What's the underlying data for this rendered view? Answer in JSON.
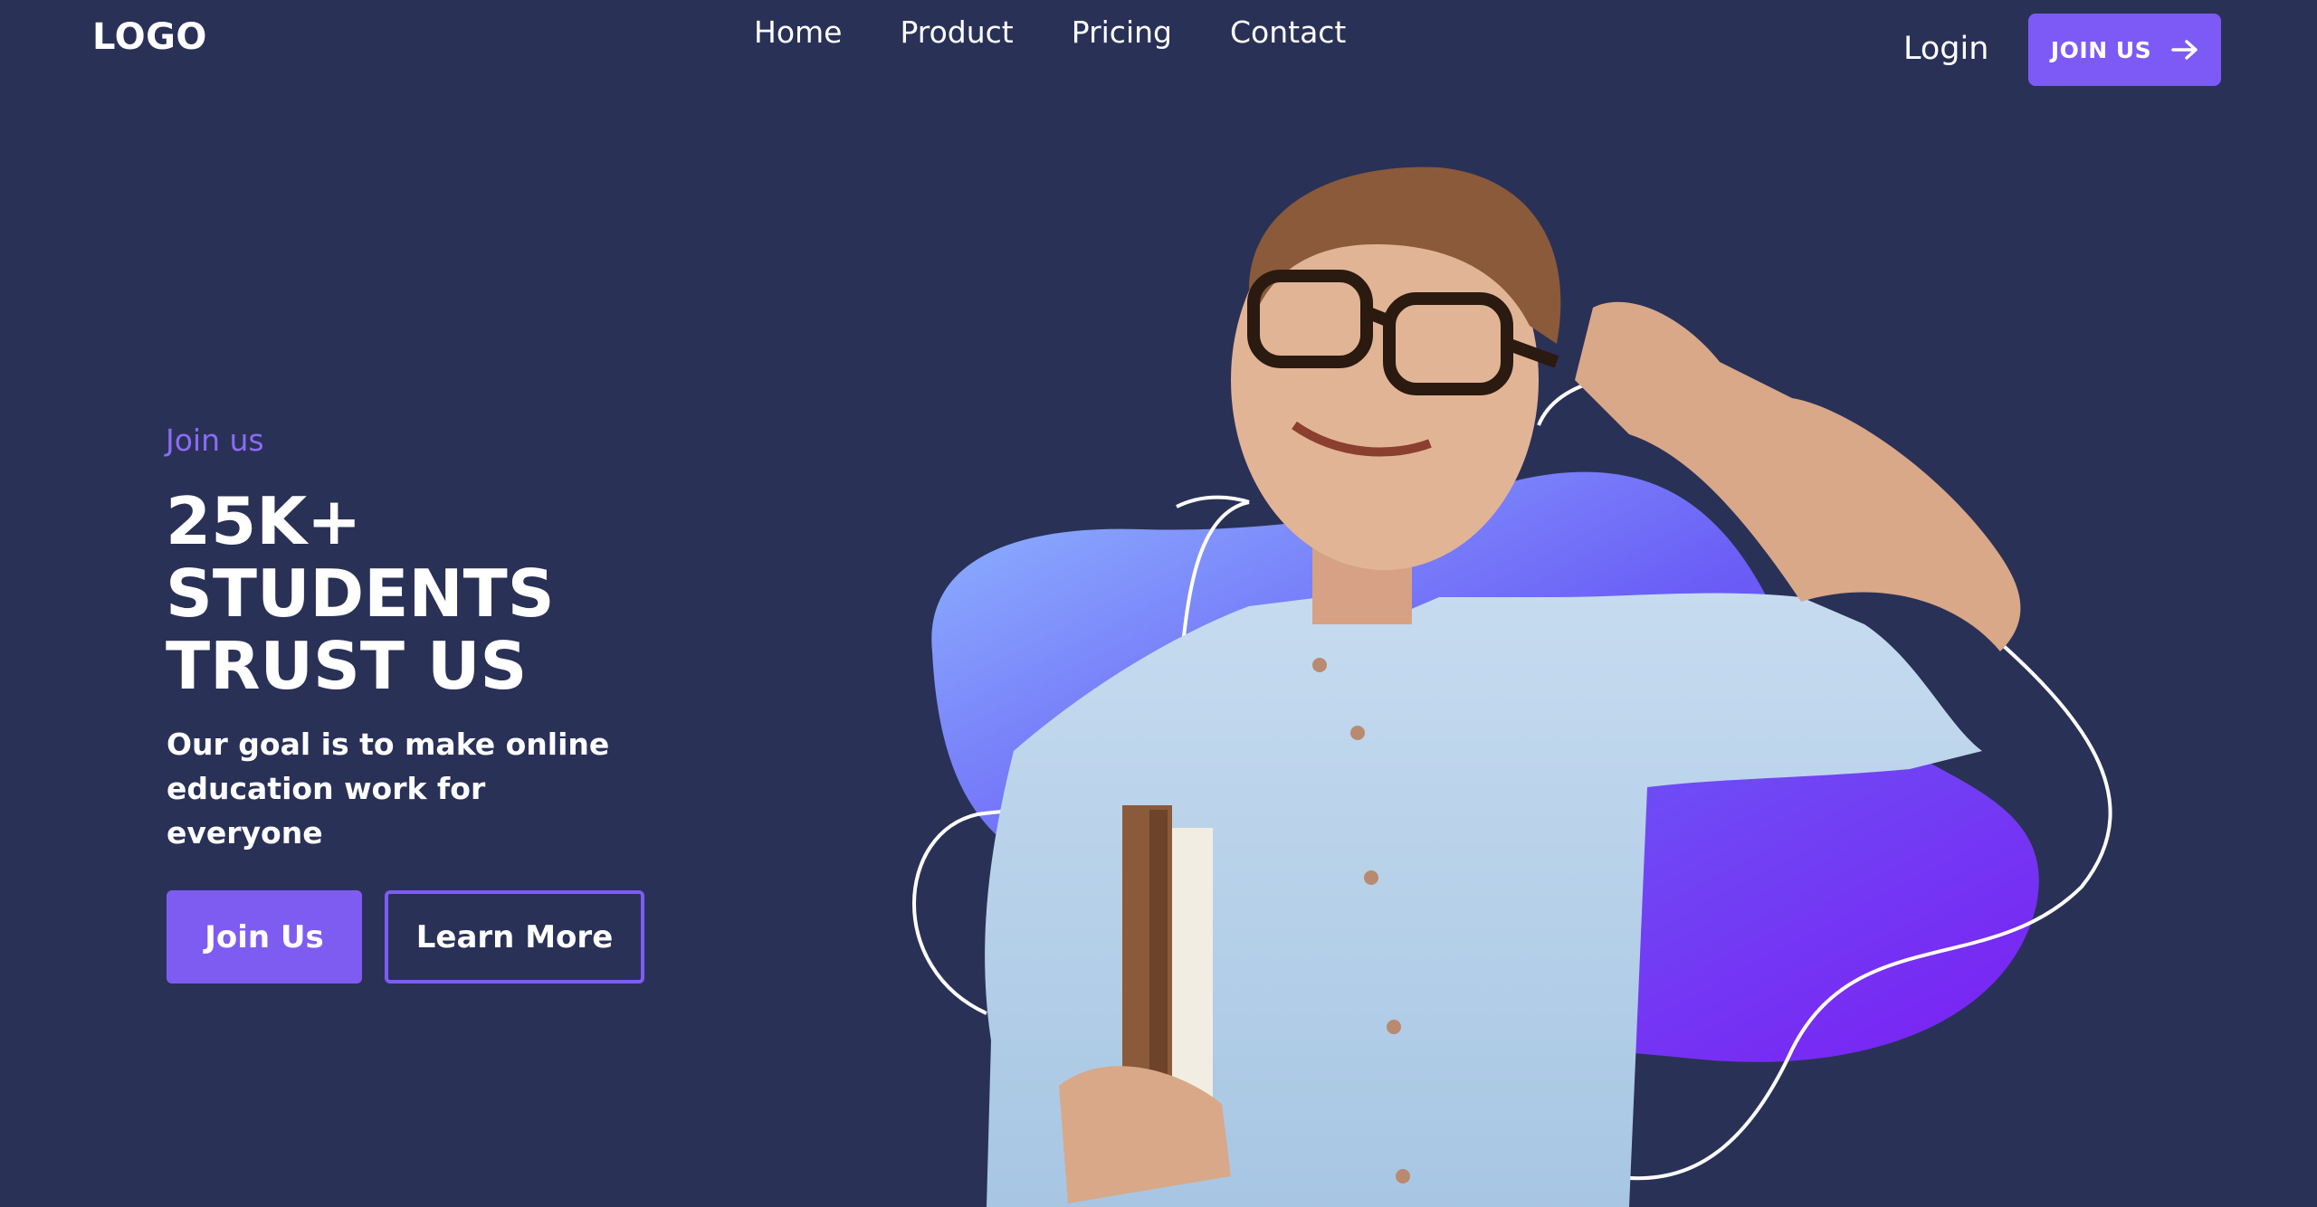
{
  "header": {
    "logo": "LOGO",
    "nav": [
      "Home",
      "Product",
      "Pricing",
      "Contact"
    ],
    "login": "Login",
    "join_button": "JOIN US"
  },
  "hero": {
    "kicker": "Join us",
    "headline": [
      "25K+",
      "STUDENTS",
      "TRUST US"
    ],
    "subtitle": "Our goal is to make online education work for everyone",
    "primary_button": "Join Us",
    "secondary_button": "Learn More"
  },
  "colors": {
    "background": "#2a3157",
    "accent": "#7d5af5",
    "blob_light": "#8fb8ff",
    "blob_dark": "#7a2cf4"
  },
  "icons": {
    "join_arrow": "arrow-right-icon"
  }
}
